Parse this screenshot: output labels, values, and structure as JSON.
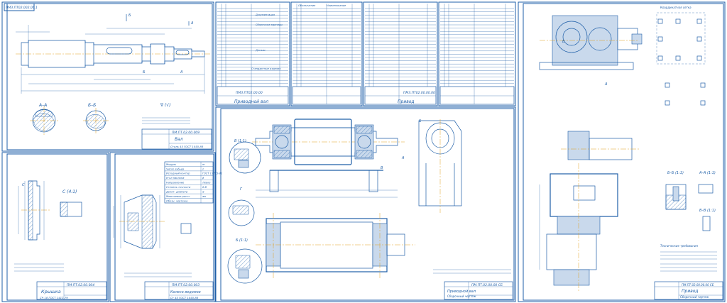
{
  "sheets": {
    "shaft": {
      "stamp": "ПМЗ.ПТ02.002.06.1",
      "section_a": "А–А",
      "section_b": "Б–Б",
      "letter_a": "А",
      "letter_b": "Б",
      "roughness": "∇ (√)",
      "title_code": "ПМ.ПТ.02.00.009",
      "title_name": "Вал",
      "material": "Сталь 45 ГОСТ 1050-88"
    },
    "cover": {
      "scale_label": "С (4:1)",
      "title_code": "ПМ.ПТ.02.00.004",
      "title_name": "Крышка",
      "material": "СЧ 18 ГОСТ 1412-79"
    },
    "gear": {
      "title_code": "ПМ.ПТ.02.00.003",
      "title_name": "Колесо ведомое",
      "material": "Ст 45 ГОСТ 1050-88",
      "params_header": "Модуль",
      "params": [
        {
          "name": "Модуль",
          "val": "m"
        },
        {
          "name": "Число зубьев",
          "val": "z"
        },
        {
          "name": "Исходный контур",
          "val": "ГОСТ 13755-81"
        },
        {
          "name": "Угол наклона",
          "val": "β"
        },
        {
          "name": "Направление",
          "val": "Левое"
        },
        {
          "name": "Степень точности",
          "val": "8-В"
        },
        {
          "name": "Делит. диаметр",
          "val": "d"
        },
        {
          "name": "Межосевое расст.",
          "val": "aw"
        },
        {
          "name": "Обозн. чертежа",
          "val": ""
        }
      ]
    },
    "specs": {
      "spec1_title": "Приводной вал",
      "spec1_code": "ПМЗ.ПТ02.00.00",
      "spec2_title": "Привод",
      "spec2_code": "ПМЗ.ПТ02.00.00.00",
      "col_pos": "Поз.",
      "col_designation": "Обозначение",
      "col_name": "Наименование",
      "sec_docs": "Документация",
      "sec_assy": "Сборочные единицы",
      "sec_parts": "Детали",
      "sec_std": "Стандартные изделия"
    },
    "assembly": {
      "section_b": "В (1:1)",
      "section_g": "Б (1:1)",
      "title_code": "ПМ.ПТ.02.00.00 СБ",
      "title_name": "Приводной вал",
      "title_sub": "Сборочный чертеж",
      "letter_a": "А",
      "letter_b": "Б",
      "letter_v": "В",
      "letter_g": "Г"
    },
    "drive": {
      "header": "Координатная сетка",
      "section_aa": "А–А (1:1)",
      "section_bb": "Б–Б (1:1)",
      "section_vv": "В–В (1:1)",
      "tech_title": "Технические требования",
      "title_code": "ПМ.ПТ.02.00.00.00 СБ",
      "title_name": "Привод",
      "title_sub": "Сборочный чертеж",
      "letter_a": "А"
    }
  },
  "colors": {
    "line": "#1f5fa8",
    "axis": "#e0a020",
    "fill": "#c9d9ec",
    "bg": "#ffffff"
  }
}
